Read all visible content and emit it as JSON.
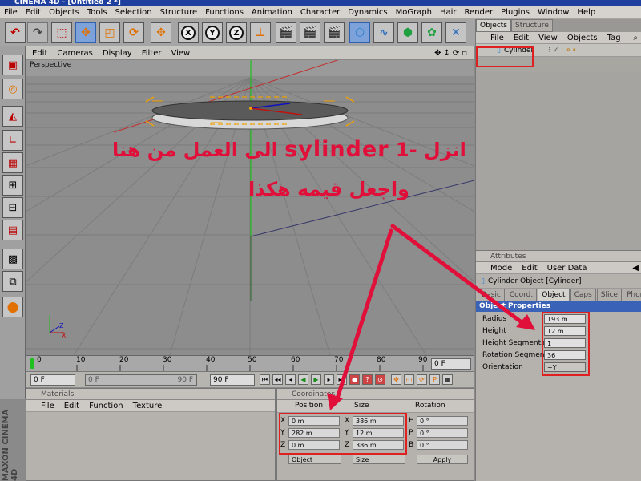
{
  "window": {
    "title": "CINEMA 4D - [Untitled 2 *]"
  },
  "menu": [
    "File",
    "Edit",
    "Objects",
    "Tools",
    "Selection",
    "Structure",
    "Functions",
    "Animation",
    "Character",
    "Dynamics",
    "MoGraph",
    "Hair",
    "Render",
    "Plugins",
    "Window",
    "Help"
  ],
  "toolbar": {
    "x_label": "X",
    "y_label": "Y",
    "z_label": "Z"
  },
  "viewport": {
    "menu": [
      "Edit",
      "Cameras",
      "Display",
      "Filter",
      "View"
    ],
    "label": "Perspective",
    "axis_x": "X",
    "axis_z": "Z"
  },
  "timeline": {
    "ticks": [
      "0",
      "10",
      "20",
      "30",
      "40",
      "50",
      "60",
      "70",
      "80",
      "90"
    ],
    "frame_right": "0 F"
  },
  "playbar": {
    "current": "0 F",
    "start": "0 F",
    "end": "90 F",
    "end2": "90 F"
  },
  "objects_panel": {
    "tabs": [
      "Objects",
      "Structure"
    ],
    "menu": [
      "File",
      "Edit",
      "View",
      "Objects",
      "Tag"
    ],
    "item": "Cylinder"
  },
  "attributes": {
    "title": "Attributes",
    "menu": [
      "Mode",
      "Edit",
      "User Data"
    ],
    "object_name": "Cylinder Object [Cylinder]",
    "tabs": [
      "Basic",
      "Coord.",
      "Object",
      "Caps",
      "Slice",
      "Phong"
    ],
    "section": "Object Properties",
    "props": [
      {
        "label": "Radius",
        "value": "193 m"
      },
      {
        "label": "Height",
        "value": "12 m"
      },
      {
        "label": "Height Segments",
        "value": "1"
      },
      {
        "label": "Rotation Segments",
        "value": "36"
      },
      {
        "label": "Orientation",
        "value": "+Y"
      }
    ]
  },
  "materials": {
    "title": "Materials",
    "menu": [
      "File",
      "Edit",
      "Function",
      "Texture"
    ]
  },
  "coordinates": {
    "title": "Coordinates",
    "headers": {
      "position": "Position",
      "size": "Size",
      "rotation": "Rotation"
    },
    "rows": [
      {
        "axis": "X",
        "pos": "0 m",
        "size_axis": "X",
        "size": "386 m",
        "rot_axis": "H",
        "rot": "0 °"
      },
      {
        "axis": "Y",
        "pos": "282 m",
        "size_axis": "Y",
        "size": "12 m",
        "rot_axis": "P",
        "rot": "0 °"
      },
      {
        "axis": "Z",
        "pos": "0 m",
        "size_axis": "Z",
        "size": "386 m",
        "rot_axis": "B",
        "rot": "0 °"
      }
    ],
    "mode1": "Object",
    "mode2": "Size",
    "apply": "Apply"
  },
  "annotation": {
    "line1_prefix": "1- انزل",
    "line1_word": "sylinder",
    "line1_suffix": "الى العمل من هنا",
    "line2": "واجعل قيمه هكذا"
  },
  "logo": {
    "text": "MAXON CINEMA 4D"
  },
  "colors": {
    "annotation": "#e0103a",
    "selected_tab": "#3a63b8",
    "titlebar": "#1e3f9e"
  }
}
